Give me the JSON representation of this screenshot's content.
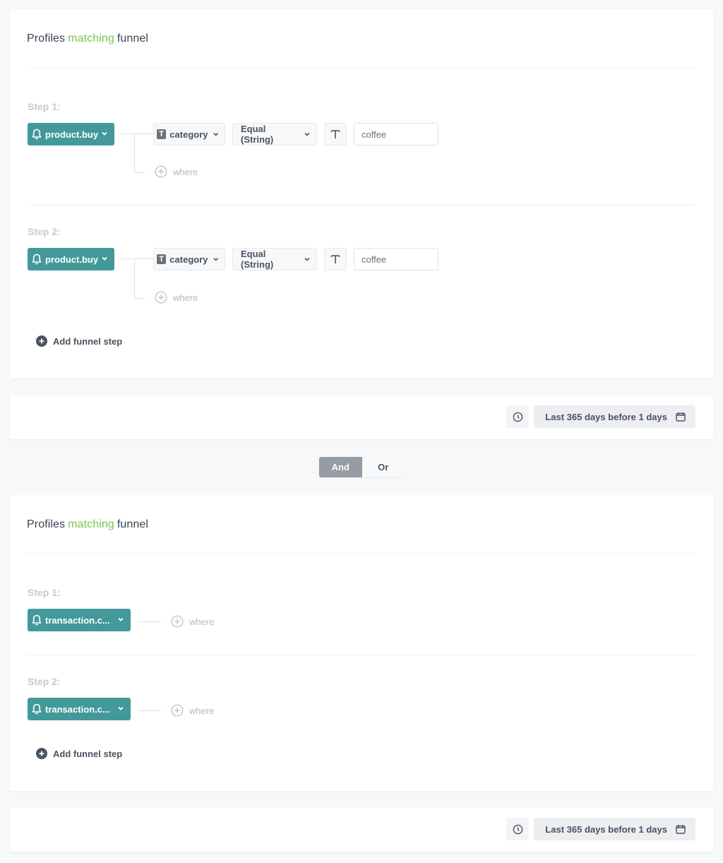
{
  "colors": {
    "accent_teal": "#43999a",
    "highlight_green": "#76c552",
    "toggle_active": "#959ca3"
  },
  "funnels": [
    {
      "title": {
        "prefix": "Profiles",
        "highlight": "matching",
        "suffix": "funnel"
      },
      "steps": [
        {
          "label": "Step 1:",
          "event": "product.buy",
          "event_icon": "bell-icon",
          "filter": {
            "param": "category",
            "param_type_icon": "text-type-icon",
            "operator": "Equal (String)",
            "value_type_icon": "text-type-icon",
            "value": "coffee"
          },
          "where_label": "where"
        },
        {
          "label": "Step 2:",
          "event": "product.buy",
          "event_icon": "bell-icon",
          "filter": {
            "param": "category",
            "param_type_icon": "text-type-icon",
            "operator": "Equal (String)",
            "value_type_icon": "text-type-icon",
            "value": "coffee"
          },
          "where_label": "where"
        }
      ],
      "add_step_label": "Add funnel step",
      "time_range": {
        "clock_icon": "clock-icon",
        "label": "Last 365 days before 1 days",
        "calendar_icon": "calendar-icon"
      }
    },
    {
      "title": {
        "prefix": "Profiles",
        "highlight": "matching",
        "suffix": "funnel"
      },
      "steps": [
        {
          "label": "Step 1:",
          "event": "transaction.c...",
          "event_icon": "bell-icon",
          "where_label": "where"
        },
        {
          "label": "Step 2:",
          "event": "transaction.c...",
          "event_icon": "bell-icon",
          "where_label": "where"
        }
      ],
      "add_step_label": "Add funnel step",
      "time_range": {
        "clock_icon": "clock-icon",
        "label": "Last 365 days before 1 days",
        "calendar_icon": "calendar-icon"
      }
    }
  ],
  "logic_toggle": {
    "options": [
      "And",
      "Or"
    ],
    "selected": "And"
  }
}
